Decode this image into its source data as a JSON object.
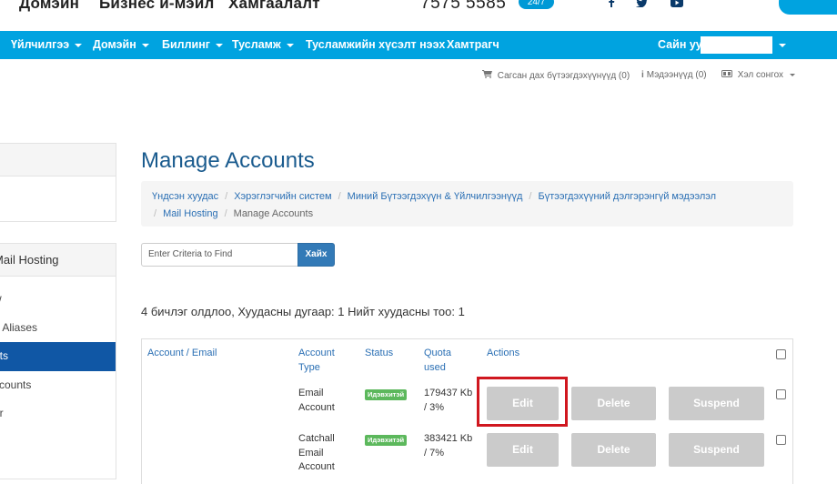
{
  "topbar": {
    "links": [
      "Домэйн",
      "Бизнес и-мэйл",
      "Хамгаалалт"
    ],
    "phone": "7575 5585",
    "badge": "24/7",
    "social_icons": [
      "facebook-icon",
      "twitter-icon",
      "youtube-icon"
    ]
  },
  "nav": {
    "items": [
      "Үйлчилгээ",
      "Домэйн",
      "Биллинг",
      "Тусламж",
      "Тусламжийн хүсэлт нээх",
      "Хамтрагч"
    ],
    "greeting": "Сайн уу,"
  },
  "subnav": {
    "cart": "Сагсан дах бүтээгдэхүүнүүд (0)",
    "notifications": "Мэдээнүүд (0)",
    "language": "Хэл сонгох"
  },
  "sidebar": {
    "panel_title": "Mail Hosting",
    "items": [
      "w",
      "n Aliases",
      "nts",
      "ccounts",
      "er"
    ]
  },
  "main": {
    "title": "Manage Accounts",
    "breadcrumb": [
      "Үндсэн хуудас",
      "Хэрэглэгчийн систем",
      "Миний Бүтээгдэхүүн & Үйлчилгээнүүд",
      "Бүтээгдэхүүний дэлгэрэнгүй мэдээлэл",
      "Mail Hosting",
      "Manage Accounts"
    ],
    "search_placeholder": "Enter Criteria to Find",
    "search_button": "Хайх",
    "results_text": "4 бичлэг олдлоо, Хуудасны дугаар: 1 Нийт хуудасны тоо: 1"
  },
  "table": {
    "headers": {
      "account": "Account / Email",
      "type_1": "Account",
      "type_2": "Type",
      "status": "Status",
      "quota_1": "Quota",
      "quota_2": "used",
      "actions": "Actions"
    },
    "rows": [
      {
        "type_lines": [
          "Email",
          "Account"
        ],
        "status": "Идэвхитэй",
        "quota_lines": [
          "179437 Kb",
          "/ 3%"
        ],
        "edit": "Edit",
        "delete": "Delete",
        "suspend": "Suspend"
      },
      {
        "type_lines": [
          "Catchall",
          "Email",
          "Account"
        ],
        "status": "Идэвхитэй",
        "quota_lines": [
          "383421 Kb",
          "/ 7%"
        ],
        "edit": "Edit",
        "delete": "Delete",
        "suspend": "Suspend"
      }
    ]
  },
  "colors": {
    "nav_bg": "#00a3e0",
    "title": "#1a5b8e",
    "link": "#2a6fb4",
    "active_side": "#1057a5",
    "status_badge": "#5cb85c",
    "action_btn": "#cbcbcb",
    "highlight": "#d0171f"
  }
}
